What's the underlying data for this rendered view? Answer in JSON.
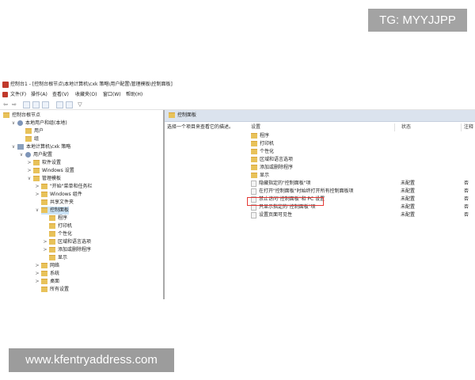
{
  "watermark": {
    "top_right": "TG: MYYJJPP",
    "bottom_left": "www.kfentryaddress.com"
  },
  "window": {
    "title": "控制台1 - [控制台根节点\\本地计算机\\cxk 策略\\用户配置\\管理模板\\控制面板]",
    "menu": [
      "文件(F)",
      "操作(A)",
      "查看(V)",
      "收藏夹(O)",
      "窗口(W)",
      "帮助(H)"
    ]
  },
  "tree": [
    {
      "label": "控制台根节点",
      "icon": "folder",
      "level": 0
    },
    {
      "label": "本地用户和组(本地)",
      "icon": "people",
      "level": 1,
      "expander": "∨"
    },
    {
      "label": "用户",
      "icon": "folder",
      "level": 2
    },
    {
      "label": "组",
      "icon": "folder",
      "level": 2
    },
    {
      "label": "本地计算机\\cxk 策略",
      "icon": "computer",
      "level": 1,
      "expander": "∨"
    },
    {
      "label": "用户配置",
      "icon": "people",
      "level": 2,
      "expander": "∨"
    },
    {
      "label": "软件设置",
      "icon": "folder",
      "level": 3,
      "expander": ">"
    },
    {
      "label": "Windows 设置",
      "icon": "folder",
      "level": 3,
      "expander": ">"
    },
    {
      "label": "管理模板",
      "icon": "folder",
      "level": 3,
      "expander": "∨"
    },
    {
      "label": "\"开始\"菜单和任务栏",
      "icon": "folder",
      "level": 4,
      "expander": ">"
    },
    {
      "label": "Windows 组件",
      "icon": "folder",
      "level": 4,
      "expander": ">"
    },
    {
      "label": "共享文件夹",
      "icon": "folder",
      "level": 4
    },
    {
      "label": "控制面板",
      "icon": "folder",
      "level": 4,
      "expander": "∨",
      "selected": true
    },
    {
      "label": "程序",
      "icon": "folder",
      "level": 5
    },
    {
      "label": "打印机",
      "icon": "folder",
      "level": 5
    },
    {
      "label": "个性化",
      "icon": "folder",
      "level": 5
    },
    {
      "label": "区域和语言选项",
      "icon": "folder",
      "level": 5,
      "expander": ">"
    },
    {
      "label": "添加或删除程序",
      "icon": "folder",
      "level": 5,
      "expander": ">"
    },
    {
      "label": "显示",
      "icon": "folder",
      "level": 5
    },
    {
      "label": "网络",
      "icon": "folder",
      "level": 4,
      "expander": ">"
    },
    {
      "label": "系统",
      "icon": "folder",
      "level": 4,
      "expander": ">"
    },
    {
      "label": "桌面",
      "icon": "folder",
      "level": 4,
      "expander": ">"
    },
    {
      "label": "所有设置",
      "icon": "folder",
      "level": 4
    }
  ],
  "right": {
    "header": "控制面板",
    "description": "选择一个项目来查看它的描述。",
    "columns": {
      "setting": "设置",
      "state": "状态",
      "note": "注释"
    },
    "rows": [
      {
        "name": "程序",
        "icon": "folder",
        "state": "",
        "note": ""
      },
      {
        "name": "打印机",
        "icon": "folder",
        "state": "",
        "note": ""
      },
      {
        "name": "个性化",
        "icon": "folder",
        "state": "",
        "note": ""
      },
      {
        "name": "区域和语言选项",
        "icon": "folder",
        "state": "",
        "note": ""
      },
      {
        "name": "添加或删除程序",
        "icon": "folder",
        "state": "",
        "note": ""
      },
      {
        "name": "显示",
        "icon": "folder",
        "state": "",
        "note": ""
      },
      {
        "name": "隐藏指定的\"控制面板\"项",
        "icon": "setting",
        "state": "未配置",
        "note": "否"
      },
      {
        "name": "在打开\"控制面板\"时始终打开所有控制面板项",
        "icon": "setting",
        "state": "未配置",
        "note": "否"
      },
      {
        "name": "禁止访问\"控制面板\"和 PC 设置",
        "icon": "setting",
        "state": "未配置",
        "note": "否"
      },
      {
        "name": "只显示指定的\"控制面板\"项",
        "icon": "setting",
        "state": "未配置",
        "note": "否"
      },
      {
        "name": "设置页面可见性",
        "icon": "setting",
        "state": "未配置",
        "note": "否"
      }
    ]
  },
  "colors": {
    "selection": "#cce4f7",
    "highlight_border": "#e53935",
    "folder": "#e8c25a"
  }
}
